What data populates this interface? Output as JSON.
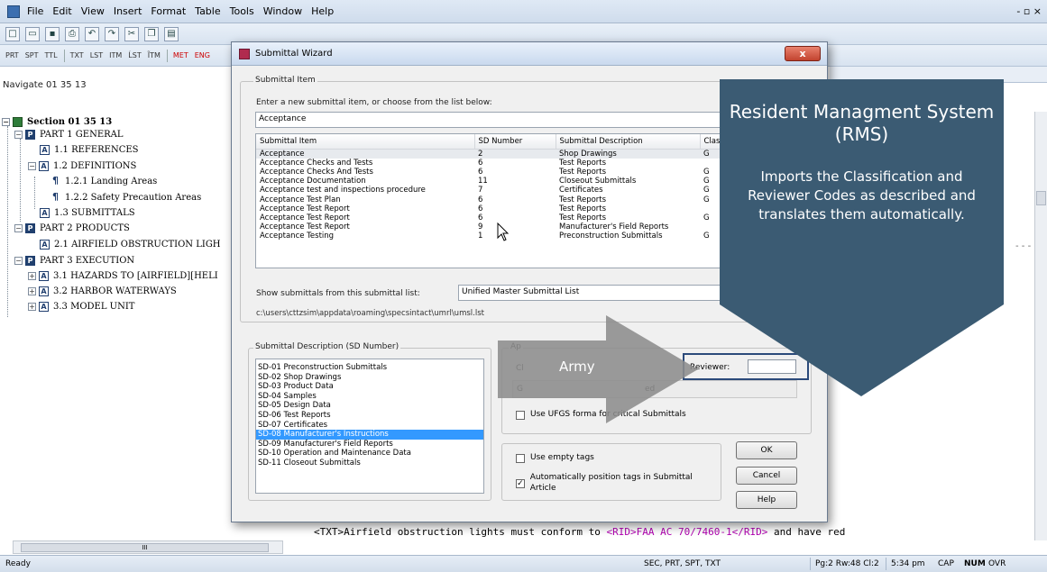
{
  "app": {
    "menu": [
      "File",
      "Edit",
      "View",
      "Insert",
      "Format",
      "Table",
      "Tools",
      "Window",
      "Help"
    ],
    "window_controls": "- ▫ ×",
    "toolbar2": [
      "PRT",
      "SPT",
      "TTL",
      "TXT",
      "LST",
      "ITM",
      "ĹST",
      "ĨTM",
      "MET",
      "ENG"
    ],
    "navigate": "Navigate 01 35 13"
  },
  "tree": {
    "items": [
      "Section 01 35 13",
      "PART 1  GENERAL",
      "1.1    REFERENCES",
      "1.2    DEFINITIONS",
      "1.2.1   Landing Areas",
      "1.2.2   Safety Precaution Areas",
      "1.3    SUBMITTALS",
      "PART 2  PRODUCTS",
      "2.1    AIRFIELD OBSTRUCTION LIGH",
      "PART 3  EXECUTION",
      "3.1    HAZARDS TO [AIRFIELD][HELI",
      "3.2    HARBOR WATERWAYS",
      "3.3    MODEL UNIT"
    ]
  },
  "editor": {
    "code_prefix": "<TXT>Airfield obstruction lights must conform to ",
    "code_rid": "<RID>FAA AC 70/7460-1</RID>",
    "code_suffix": " and have red",
    "dashes": "- - -",
    "hscroll_thumb": "III"
  },
  "status": {
    "ready": "Ready",
    "tags": "SEC, PRT, SPT, TXT",
    "position": "Pg:2 Rw:48 Cl:2",
    "time": "5:34 pm",
    "cap": "CAP",
    "num": "NUM",
    "ovr": "OVR"
  },
  "dialog": {
    "title": "Submittal Wizard",
    "close": "x",
    "submittal_item_group": "Submittal Item",
    "prompt": "Enter a new submittal item, or choose from the list below:",
    "item_value": "Acceptance",
    "columns": [
      "Submittal Item",
      "SD Number",
      "Submittal Description",
      "Clas"
    ],
    "rows": [
      [
        "Acceptance",
        "2",
        "Shop Drawings",
        "G"
      ],
      [
        "Acceptance Checks and Tests",
        "6",
        "Test Reports",
        ""
      ],
      [
        "Acceptance Checks And Tests",
        "6",
        "Test Reports",
        "G"
      ],
      [
        "Acceptance Documentation",
        "11",
        "Closeout Submittals",
        "G"
      ],
      [
        "Acceptance test and inspections procedure",
        "7",
        "Certificates",
        "G"
      ],
      [
        "Acceptance Test Plan",
        "6",
        "Test Reports",
        "G"
      ],
      [
        "Acceptance Test Report",
        "6",
        "Test Reports",
        ""
      ],
      [
        "Acceptance Test Report",
        "6",
        "Test Reports",
        "G"
      ],
      [
        "Acceptance Test Report",
        "9",
        "Manufacturer's Field Reports",
        ""
      ],
      [
        "Acceptance Testing",
        "1",
        "Preconstruction Submittals",
        "G"
      ]
    ],
    "show_label": "Show submittals from this submittal list:",
    "list_name": "Unified Master Submittal List",
    "list_path": "c:\\users\\cttzsim\\appdata\\roaming\\specsintact\\umrl\\umsl.lst",
    "desc_group": "Submittal Description (SD Number)",
    "descriptions": [
      "SD-01 Preconstruction Submittals",
      "SD-02 Shop Drawings",
      "SD-03 Product Data",
      "SD-04 Samples",
      "SD-05 Design Data",
      "SD-06 Test Reports",
      "SD-07 Certificates",
      "SD-08 Manufacturer's Instructions",
      "SD-09 Manufacturer's Field Reports",
      "SD-10 Operation and Maintenance Data",
      "SD-11 Closeout Submittals"
    ],
    "selected_description_index": 7,
    "approval_group": "Ap",
    "cl_label": "Cl",
    "g_value": "G",
    "ed_text": "ed",
    "reviewer_label": "Reviewer:",
    "ufgs_label": "Use UFGS forma   for critical Submittals",
    "empty_tags_label": "Use empty tags",
    "auto_position_label": "Automatically position tags in Submittal Article",
    "auto_position_checked": true,
    "ok": "OK",
    "cancel": "Cancel",
    "help": "Help"
  },
  "callout": {
    "title": "Resident Managment System (RMS)",
    "body": "Imports the Classification and Reviewer Codes as described and translates them automatically.",
    "arrow_label": "Army",
    "color": "#3b5b73"
  }
}
